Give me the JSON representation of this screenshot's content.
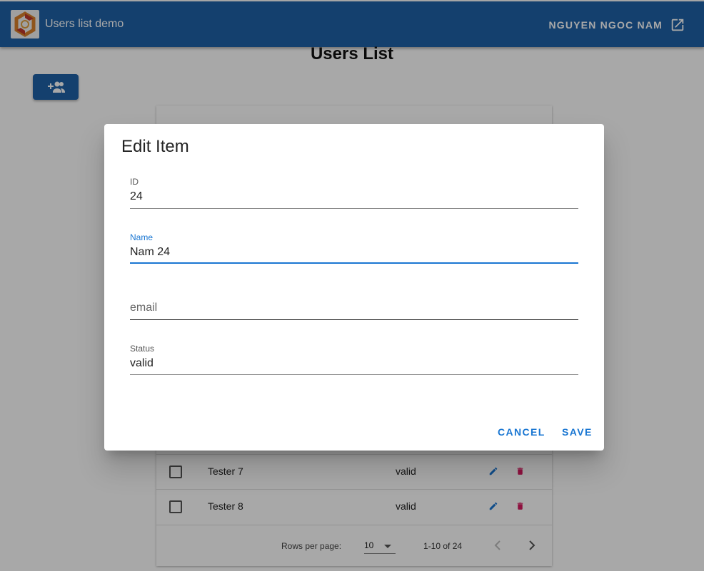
{
  "appbar": {
    "title": "Users list demo",
    "user_name": "NGUYEN NGOC NAM",
    "logo_icon": "app-logo",
    "external_link_icon": "open-in-new-icon",
    "color": "#1f62a8"
  },
  "page": {
    "title": "Users List",
    "add_user_icon": "add-group-icon"
  },
  "table": {
    "rows": [
      {
        "name": "Tester 7",
        "status": "valid"
      },
      {
        "name": "Tester 8",
        "status": "valid"
      }
    ],
    "footer": {
      "rows_per_page_label": "Rows per page:",
      "rows_per_page_value": "10",
      "range": "1-10 of 24"
    }
  },
  "dialog": {
    "title": "Edit Item",
    "fields": {
      "id": {
        "label": "ID",
        "value": "24"
      },
      "name": {
        "label": "Name",
        "value": "Nam 24"
      },
      "email": {
        "placeholder": "email",
        "value": ""
      },
      "status": {
        "label": "Status",
        "value": "valid"
      }
    },
    "cancel_label": "CANCEL",
    "save_label": "SAVE",
    "accent_color": "#1976d2"
  }
}
